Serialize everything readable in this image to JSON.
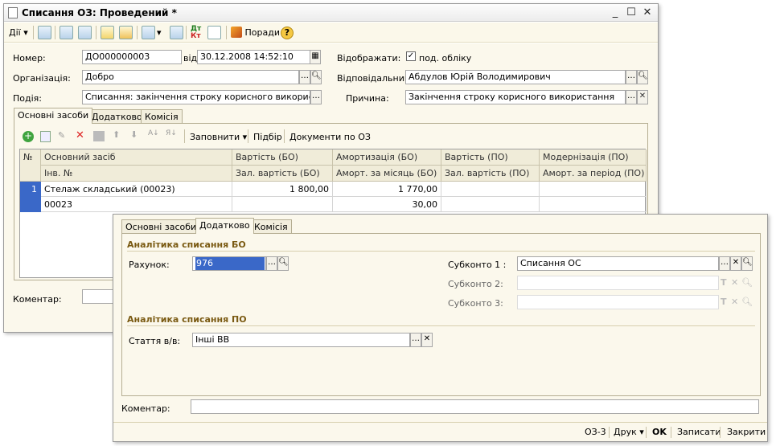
{
  "window1": {
    "title": "Списання ОЗ: Проведений *",
    "toolbar": {
      "actions_label": "Дії",
      "advice_label": "Поради",
      "help_label": "?"
    },
    "fields": {
      "number_label": "Номер:",
      "number_value": "ДО000000003",
      "date_label": "від:",
      "date_value": "30.12.2008 14:52:10",
      "display_label": "Відображати:",
      "display_check_label": "под. обліку",
      "org_label": "Організація:",
      "org_value": "Добро",
      "responsible_label": "Відповідальний:",
      "responsible_value": "Абдулов Юрій Володимирович",
      "event_label": "Подія:",
      "event_value": "Списання: закінчення строку корисного використання",
      "reason_label": "Причина:",
      "reason_value": "Закінчення строку корисного використання",
      "comment_label": "Коментар:"
    },
    "tabs": [
      "Основні засоби",
      "Додатково",
      "Комісія"
    ],
    "grid_toolbar": {
      "fill_label": "Заповнити",
      "select_label": "Підбір",
      "docs_label": "Документи по ОЗ"
    },
    "grid": {
      "headers_top": [
        "№",
        "Основний засіб",
        "Вартість (БО)",
        "Амортизація (БО)",
        "Вартість (ПО)",
        "Модернізація (ПО)"
      ],
      "headers_bottom": [
        "",
        "Інв. №",
        "Зал. вартість (БО)",
        "Аморт. за місяць (БО)",
        "Зал. вартість (ПО)",
        "Аморт. за період (ПО)"
      ],
      "rows": [
        {
          "n": "1",
          "asset": "Стелаж складський (00023)",
          "cost_bo": "1 800,00",
          "amort_bo": "1 770,00",
          "cost_po": "",
          "modern_po": "",
          "inv": "00023",
          "resid_bo": "",
          "amort_month": "30,00",
          "resid_po": "",
          "amort_period": ""
        }
      ]
    }
  },
  "window2": {
    "tabs": [
      "Основні засоби",
      "Додатково",
      "Комісія"
    ],
    "section_bo": "Аналітика списання БО",
    "account_label": "Рахунок:",
    "account_value": "976",
    "sub1_label": "Субконто 1 :",
    "sub1_value": "Списання ОС",
    "sub2_label": "Субконто 2:",
    "sub3_label": "Субконто 3:",
    "section_po": "Аналітика списання ПО",
    "article_label": "Стаття в/в:",
    "article_value": "Інші ВВ",
    "comment_label": "Коментар:",
    "statusbar": {
      "form_label": "ОЗ-3",
      "print_label": "Друк",
      "ok_label": "OK",
      "save_label": "Записати",
      "close_label": "Закрити"
    }
  },
  "colors": {
    "accent_section": "#7a5a12",
    "selection": "#3a68c8",
    "panel_bg": "#fbf8ec"
  }
}
